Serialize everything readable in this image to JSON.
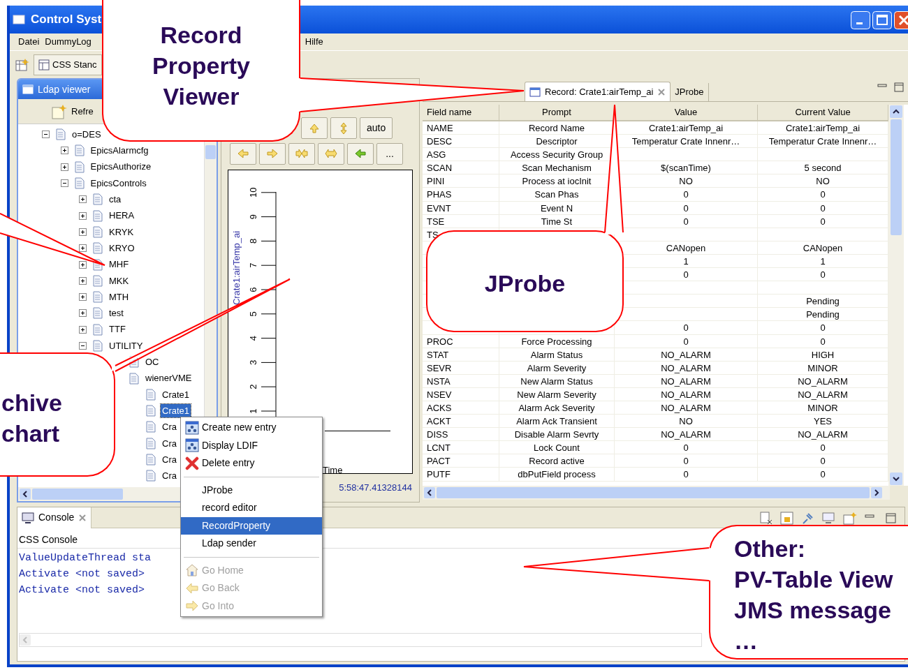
{
  "window": {
    "title": "Control Syst"
  },
  "menu": [
    "Datei",
    "DummyLog",
    "Hilfe"
  ],
  "perspective": {
    "label": "CSS Stanc"
  },
  "ldap_viewer": {
    "title": "Ldap viewer",
    "refresh": "Refre",
    "tree": [
      {
        "label": "o=DES",
        "expanded": true,
        "selected": false,
        "children": [
          {
            "label": "EpicsAlarmcfg",
            "expanded": false,
            "selected": false
          },
          {
            "label": "EpicsAuthorize",
            "expanded": false,
            "selected": false
          },
          {
            "label": "EpicsControls",
            "expanded": true,
            "selected": false,
            "children": [
              {
                "label": "cta",
                "expanded": false,
                "selected": false
              },
              {
                "label": "HERA",
                "expanded": false,
                "selected": false
              },
              {
                "label": "KRYK",
                "expanded": false,
                "selected": false
              },
              {
                "label": "KRYO",
                "expanded": false,
                "selected": false
              },
              {
                "label": "MHF",
                "expanded": false,
                "selected": false
              },
              {
                "label": "MKK",
                "expanded": false,
                "selected": false
              },
              {
                "label": "MTH",
                "expanded": false,
                "selected": false
              },
              {
                "label": "test",
                "expanded": false,
                "selected": false
              },
              {
                "label": "TTF",
                "expanded": false,
                "selected": false
              },
              {
                "label": "UTILITY",
                "expanded": true,
                "selected": false,
                "children": [
                  {
                    "label": "OC",
                    "selected": false
                  },
                  {
                    "label": "wienerVME",
                    "selected": false,
                    "children": [
                      {
                        "label": "Crate1",
                        "selected": false
                      },
                      {
                        "label": "Crate1",
                        "selected": true
                      },
                      {
                        "label": "Cra",
                        "selected": false
                      },
                      {
                        "label": "Cra",
                        "selected": false
                      },
                      {
                        "label": "Cra",
                        "selected": false
                      },
                      {
                        "label": "Cra",
                        "selected": false
                      }
                    ]
                  }
                ]
              }
            ]
          }
        ]
      }
    ]
  },
  "chart": {
    "auto_button": "auto",
    "more_button": "...",
    "y_tick_labels": [
      "1",
      "2",
      "3",
      "4",
      "5",
      "6",
      "7",
      "8",
      "9",
      "10"
    ],
    "y_label": "Crate1:airTemp_ai",
    "x_label": "Time",
    "timestamp": "5:58:47.41328144"
  },
  "editor_tabs": [
    {
      "label": "Record: Crate1:airTemp_ai",
      "selected": true
    },
    {
      "label": "JProbe",
      "selected": false
    }
  ],
  "table": {
    "columns": [
      "Field name",
      "Prompt",
      "Value",
      "Current Value"
    ],
    "rows": [
      {
        "field": "NAME",
        "prompt": "Record Name",
        "value": "Crate1:airTemp_ai",
        "current": "Crate1:airTemp_ai"
      },
      {
        "field": "DESC",
        "prompt": "Descriptor",
        "value": "Temperatur Crate Innenr…",
        "current": "Temperatur Crate Innenr…"
      },
      {
        "field": "ASG",
        "prompt": "Access Security Group"
      },
      {
        "field": "SCAN",
        "prompt": "Scan Mechanism",
        "value": "$(scanTime)",
        "current": "5 second"
      },
      {
        "field": "PINI",
        "prompt": "Process at iocInit",
        "value": "NO",
        "current": "NO"
      },
      {
        "field": "PHAS",
        "prompt": "Scan Phas",
        "value": "0",
        "current": "0"
      },
      {
        "field": "EVNT",
        "prompt": "Event N",
        "value": "0",
        "current": "0"
      },
      {
        "field": "TSE",
        "prompt": "Time St",
        "value": "0",
        "current": "0"
      },
      {
        "field": "TS"
      },
      {
        "value": "CANopen",
        "current": "CANopen"
      },
      {
        "value": "1",
        "current": "1"
      },
      {
        "value": "0",
        "current": "0"
      },
      {},
      {
        "current": "Pending"
      },
      {
        "current": "Pending"
      },
      {
        "value": "0",
        "current": "0"
      },
      {
        "field": "PROC",
        "prompt": "Force Processing",
        "value": "0",
        "current": "0"
      },
      {
        "field": "STAT",
        "prompt": "Alarm Status",
        "value": "NO_ALARM",
        "current": "HIGH"
      },
      {
        "field": "SEVR",
        "prompt": "Alarm Severity",
        "value": "NO_ALARM",
        "current": "MINOR"
      },
      {
        "field": "NSTA",
        "prompt": "New Alarm Status",
        "value": "NO_ALARM",
        "current": "NO_ALARM"
      },
      {
        "field": "NSEV",
        "prompt": "New Alarm Severity",
        "value": "NO_ALARM",
        "current": "NO_ALARM"
      },
      {
        "field": "ACKS",
        "prompt": "Alarm Ack Severity",
        "value": "NO_ALARM",
        "current": "MINOR"
      },
      {
        "field": "ACKT",
        "prompt": "Alarm Ack Transient",
        "value": "NO",
        "current": "YES"
      },
      {
        "field": "DISS",
        "prompt": "Disable Alarm Sevrty",
        "value": "NO_ALARM",
        "current": "NO_ALARM"
      },
      {
        "field": "LCNT",
        "prompt": "Lock Count",
        "value": "0",
        "current": "0"
      },
      {
        "field": "PACT",
        "prompt": "Record active",
        "value": "0",
        "current": "0"
      },
      {
        "field": "PUTF",
        "prompt": "dbPutField process",
        "value": "0",
        "current": "0"
      }
    ]
  },
  "context_menu": [
    [
      {
        "label": "Create new entry",
        "selected": false,
        "disabled": false
      },
      {
        "label": "Display LDIF",
        "selected": false,
        "disabled": false
      },
      {
        "label": "Delete entry",
        "selected": false,
        "disabled": false
      }
    ],
    [
      {
        "label": "JProbe",
        "selected": false,
        "disabled": false
      },
      {
        "label": "record editor",
        "selected": false,
        "disabled": false
      },
      {
        "label": "RecordProperty",
        "selected": true,
        "disabled": false
      },
      {
        "label": "Ldap sender",
        "selected": false,
        "disabled": false
      }
    ],
    [
      {
        "label": "Go Home",
        "selected": false,
        "disabled": true
      },
      {
        "label": "Go Back",
        "selected": false,
        "disabled": true
      },
      {
        "label": "Go Into",
        "selected": false,
        "disabled": true
      }
    ]
  ],
  "console": {
    "tab": "Console",
    "title": "CSS Console",
    "lines": [
      "ValueUpdateThread sta",
      "Activate <not saved>",
      "Activate <not saved>"
    ]
  },
  "callouts": [
    {
      "lines": [
        "Record",
        "Property",
        "Viewer"
      ]
    },
    {
      "lines": [
        "JProbe"
      ]
    },
    {
      "lines": [
        "chive",
        "chart"
      ]
    },
    {
      "lines": [
        "Other:",
        "PV-Table View",
        "JMS message",
        "…"
      ]
    }
  ]
}
